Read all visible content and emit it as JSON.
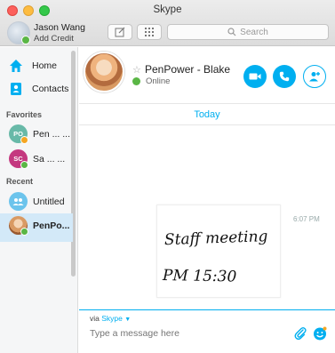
{
  "app": {
    "title": "Skype"
  },
  "profile": {
    "name": "Jason Wang",
    "credit": "Add Credit"
  },
  "toolbar": {
    "search_placeholder": "Search"
  },
  "nav": [
    {
      "label": "Home",
      "icon": "home-icon"
    },
    {
      "label": "Contacts",
      "icon": "contacts-icon"
    }
  ],
  "sections": {
    "favorites": "Favorites",
    "recent": "Recent"
  },
  "favorites": [
    {
      "initials": "PO",
      "name": "Pen ... ...",
      "color": "#68b9a8",
      "badge": "#f5a623"
    },
    {
      "initials": "SC",
      "name": "Sa ... ...",
      "color": "#c4387f",
      "badge": "#5ab645"
    }
  ],
  "recent": [
    {
      "name": "Untitled",
      "color": "#6cc4ec"
    },
    {
      "name": "PenPo...",
      "color": "#d99a63",
      "badge": "#5ab645",
      "selected": true
    }
  ],
  "conversation": {
    "name": "PenPower - Blake",
    "status": "Online",
    "date_divider": "Today",
    "message_time": "6:07 PM",
    "handwriting": [
      "Staff meeting",
      "PM 15:30"
    ]
  },
  "composer": {
    "via_label": "via",
    "via_service": "Skype",
    "placeholder": "Type a message here"
  },
  "colors": {
    "accent": "#00aff0",
    "online": "#5ab645",
    "selected_bg": "#d3e9f8"
  }
}
